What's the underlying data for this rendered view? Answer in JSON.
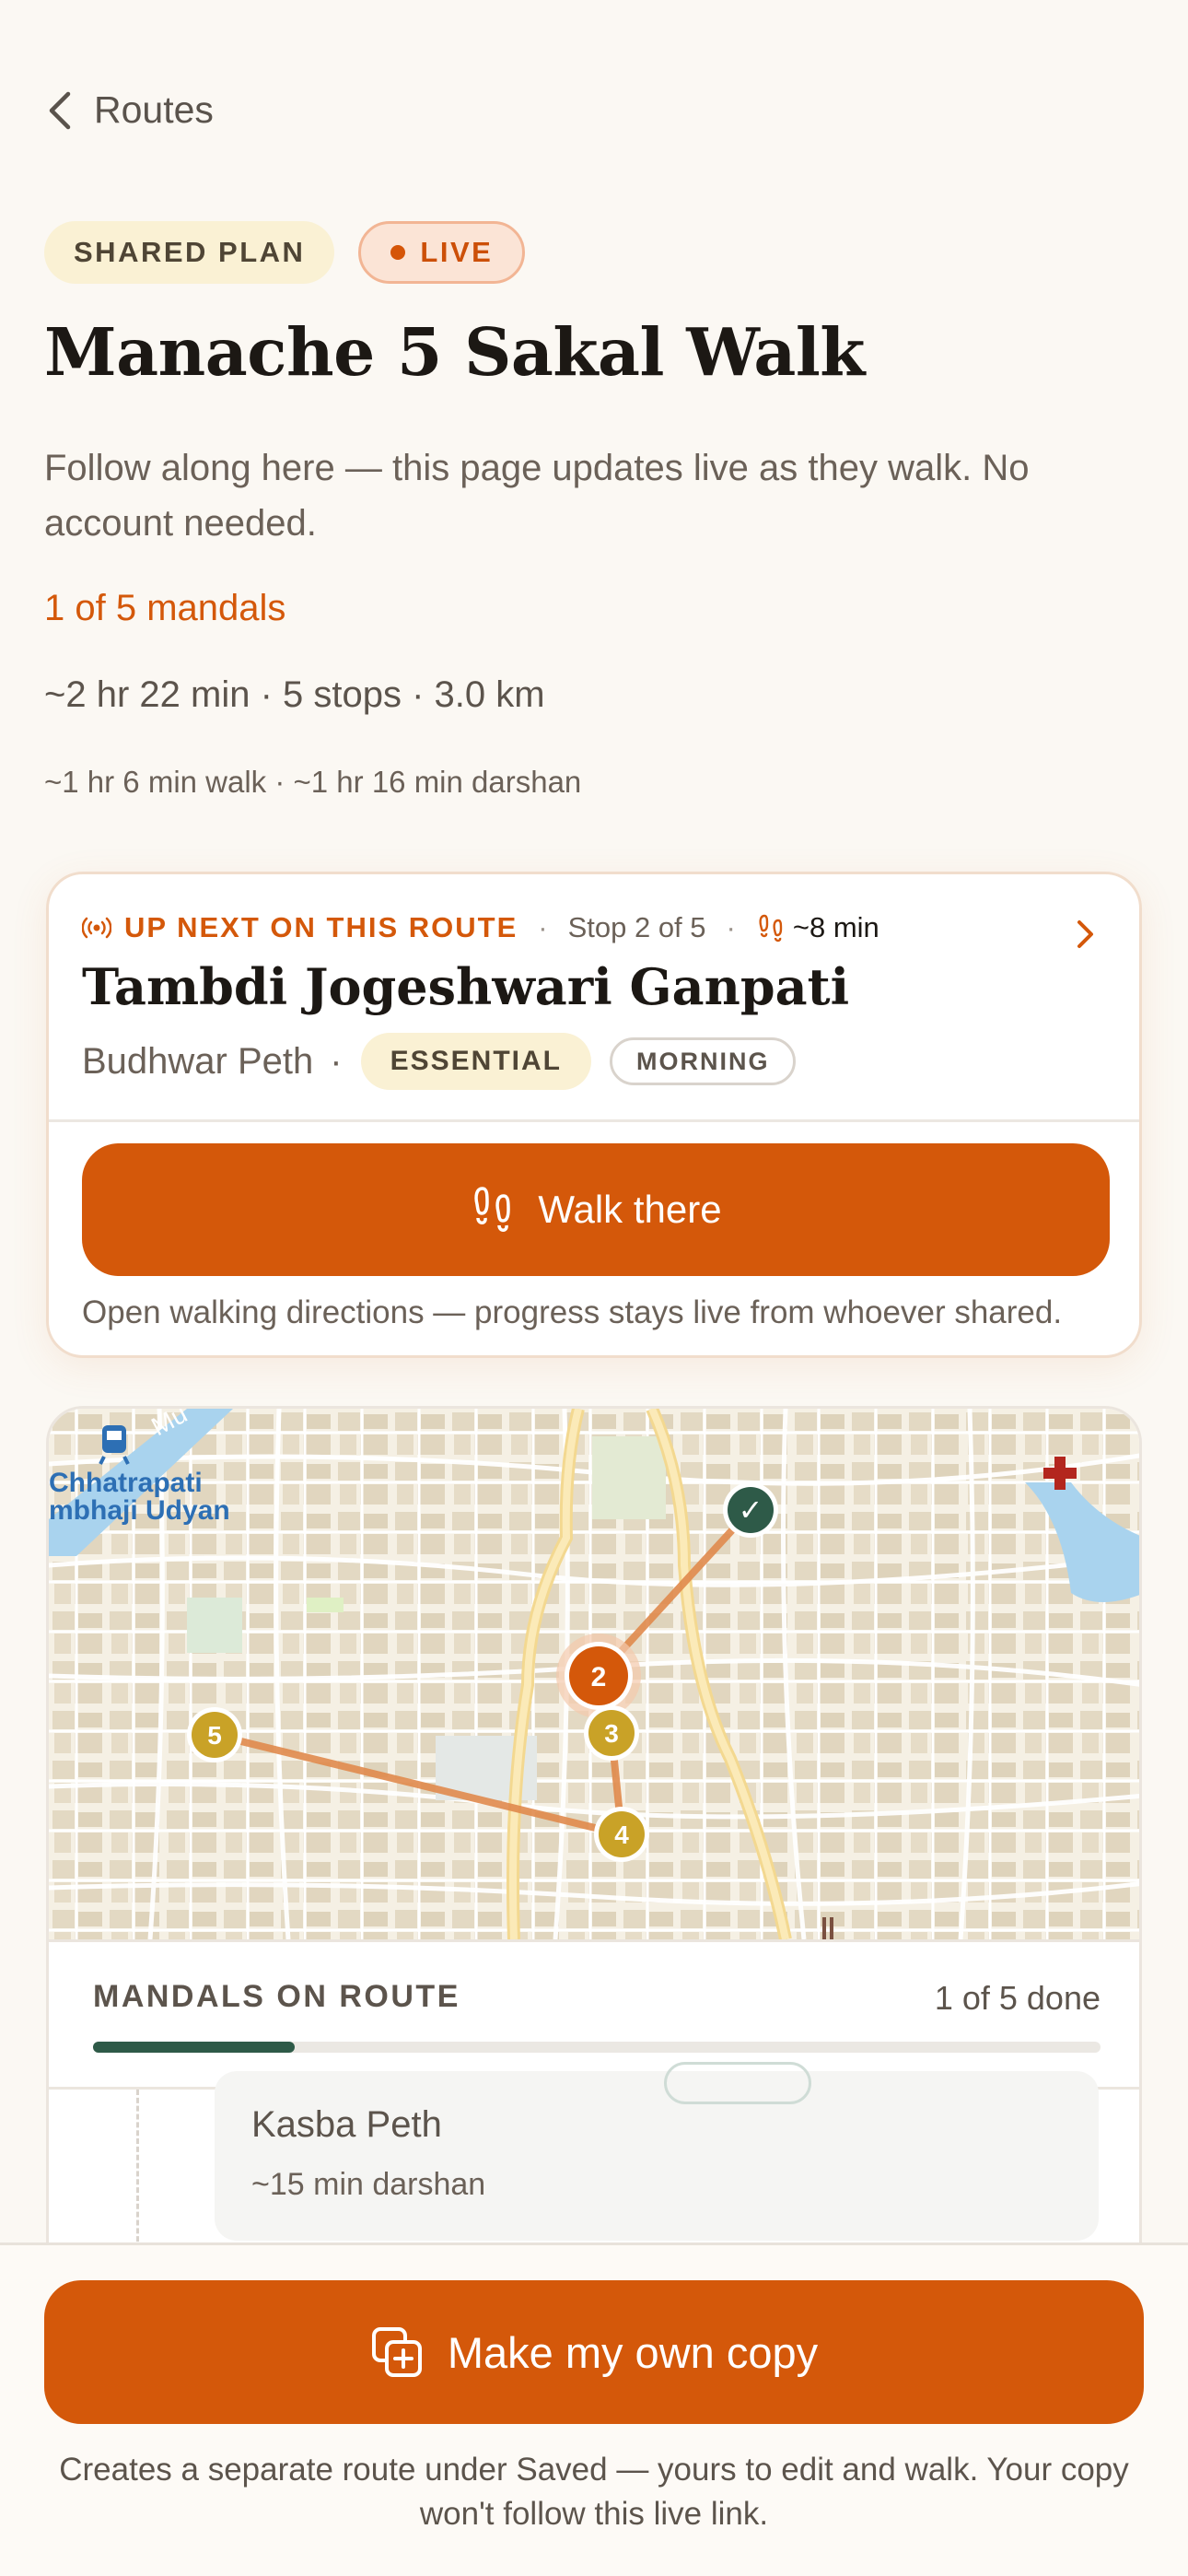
{
  "nav": {
    "back_label": "Routes"
  },
  "badges": {
    "shared": "SHARED PLAN",
    "live": "LIVE"
  },
  "plan": {
    "title": "Manache 5 Sakal Walk",
    "subtitle": "Follow along here — this page updates live as they walk. No account needed.",
    "progress": "1 of 5 mandals",
    "summary": "~2 hr 22 min · 5 stops · 3.0 km",
    "breakdown": "~1 hr 6 min walk · ~1 hr 16 min darshan"
  },
  "up_next": {
    "label": "UP NEXT ON THIS ROUTE",
    "sep": "·",
    "stop_position": "Stop 2 of 5",
    "walk_time": "~8 min",
    "name": "Tambdi Jogeshwari Ganpati",
    "locality": "Budhwar Peth",
    "locality_sep": "·",
    "tag_primary": "ESSENTIAL",
    "tag_secondary": "MORNING",
    "walk_button": "Walk there",
    "note": "Open walking directions — progress stays live from whoever shared."
  },
  "map": {
    "place_label_line1": "Chhatrapati",
    "place_label_line2": "mbhaji Udyan",
    "river_label": "Mu",
    "markers": [
      {
        "label": "✓",
        "state": "done"
      },
      {
        "label": "2",
        "state": "next"
      },
      {
        "label": "3",
        "state": "pending"
      },
      {
        "label": "4",
        "state": "pending"
      },
      {
        "label": "5",
        "state": "pending"
      }
    ],
    "colors": {
      "done": "#2e5a48",
      "next": "#d4580a",
      "pending": "#c9a227",
      "route": "#e08a4c"
    }
  },
  "mandals": {
    "title": "MANDALS ON ROUTE",
    "count": "1 of 5 done",
    "done_fraction": 0.2,
    "visible_stop": {
      "locality": "Kasba Peth",
      "darshan": "~15 min darshan"
    }
  },
  "footer": {
    "copy_button": "Make my own copy",
    "note": "Creates a separate route under Saved — yours to edit and walk. Your copy won't follow this live link."
  }
}
